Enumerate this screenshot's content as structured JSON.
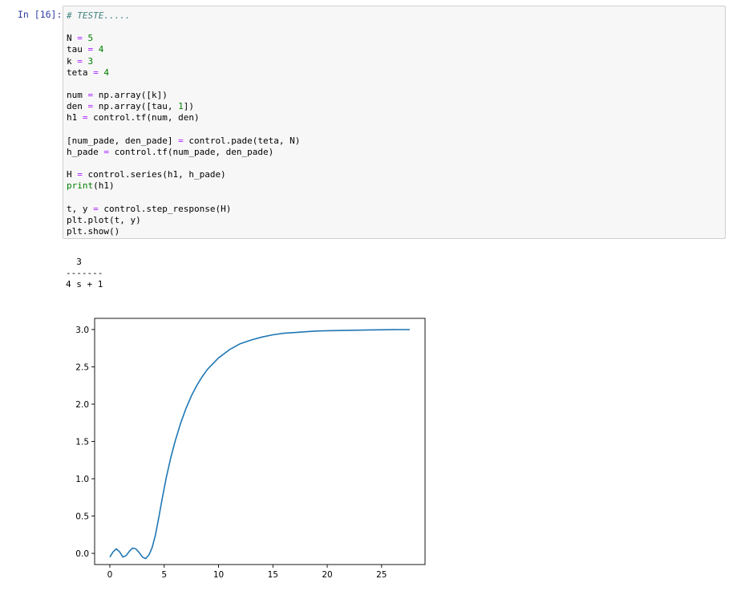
{
  "cell": {
    "prompt": "In [16]:",
    "code_lines": [
      "# TESTE.....",
      "",
      "N = 5",
      "tau = 4",
      "k = 3",
      "teta = 4",
      "",
      "num = np.array([k])",
      "den = np.array([tau, 1])",
      "h1 = control.tf(num, den)",
      "",
      "[num_pade, den_pade] = control.pade(teta, N)",
      "h_pade = control.tf(num_pade, den_pade)",
      "",
      "H = control.series(h1, h_pade)",
      "print(h1)",
      "",
      "t, y = control.step_response(H)",
      "plt.plot(t, y)",
      "plt.show()"
    ]
  },
  "output": {
    "text_lines": [
      "  3",
      "-------",
      "4 s + 1"
    ]
  },
  "colors": {
    "line": "#1f77b4",
    "prompt": "#303f9f",
    "comment": "#408080",
    "operator": "#aa22ff",
    "number": "#008000"
  },
  "chart_data": {
    "type": "line",
    "title": "",
    "xlabel": "",
    "ylabel": "",
    "xlim": [
      -1.4,
      29.0
    ],
    "ylim": [
      -0.15,
      3.15
    ],
    "xticks": [
      0,
      5,
      10,
      15,
      20,
      25
    ],
    "xtick_labels": [
      "0",
      "5",
      "10",
      "15",
      "20",
      "25"
    ],
    "yticks": [
      0.0,
      0.5,
      1.0,
      1.5,
      2.0,
      2.5,
      3.0
    ],
    "ytick_labels": [
      "0.0",
      "0.5",
      "1.0",
      "1.5",
      "2.0",
      "2.5",
      "3.0"
    ],
    "grid": false,
    "series": [
      {
        "x": [
          0.0,
          0.3,
          0.6,
          0.9,
          1.2,
          1.5,
          1.8,
          2.1,
          2.4,
          2.7,
          3.0,
          3.3,
          3.6,
          3.9,
          4.2,
          4.5,
          4.8,
          5.2,
          5.6,
          6.0,
          6.5,
          7.0,
          7.5,
          8.0,
          8.5,
          9.0,
          10.0,
          11.0,
          12.0,
          13.0,
          14.0,
          15.0,
          16.0,
          17.0,
          18.0,
          19.0,
          20.0,
          22.0,
          24.0,
          26.0,
          27.6
        ],
        "values": [
          -0.05,
          0.02,
          0.06,
          0.02,
          -0.05,
          -0.03,
          0.03,
          0.07,
          0.06,
          0.01,
          -0.05,
          -0.07,
          -0.02,
          0.08,
          0.25,
          0.48,
          0.72,
          1.02,
          1.28,
          1.5,
          1.74,
          1.94,
          2.11,
          2.25,
          2.37,
          2.47,
          2.62,
          2.73,
          2.81,
          2.86,
          2.9,
          2.93,
          2.95,
          2.96,
          2.97,
          2.98,
          2.985,
          2.99,
          2.995,
          2.998,
          3.0
        ]
      }
    ]
  }
}
